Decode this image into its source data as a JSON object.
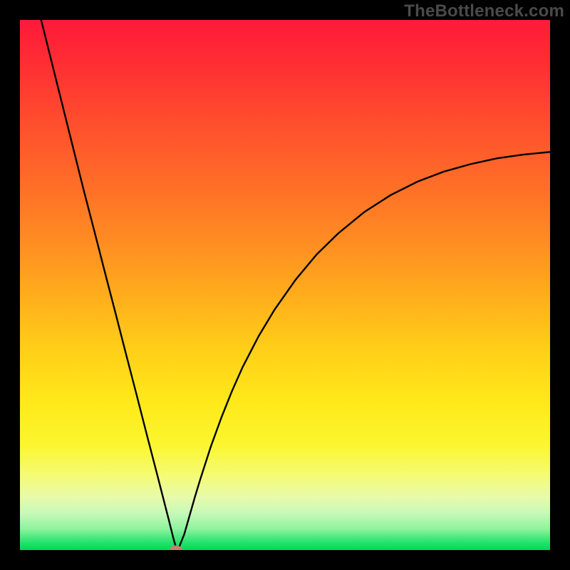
{
  "watermark": "TheBottleneck.com",
  "chart_data": {
    "type": "line",
    "title": "",
    "xlabel": "",
    "ylabel": "",
    "xlim": [
      0,
      100
    ],
    "ylim": [
      0,
      100
    ],
    "grid": false,
    "series": [
      {
        "name": "bottleneck-curve",
        "x": [
          4,
          6,
          8,
          10,
          12,
          14,
          16,
          18,
          20,
          22,
          24,
          26,
          28,
          29,
          29.5,
          30,
          31,
          32,
          33,
          34,
          36,
          38,
          40,
          42,
          45,
          48,
          52,
          56,
          60,
          65,
          70,
          75,
          80,
          85,
          90,
          95,
          100
        ],
        "y": [
          100,
          92,
          84,
          76,
          68,
          60.3,
          52.5,
          44.8,
          37,
          29.3,
          21.5,
          13.8,
          6,
          2,
          0.3,
          0.5,
          3,
          6.5,
          10,
          13.3,
          19.5,
          25,
          30,
          34.5,
          40.3,
          45.3,
          51,
          55.8,
          59.7,
          63.8,
          67,
          69.5,
          71.4,
          72.8,
          73.9,
          74.6,
          75.1
        ]
      }
    ],
    "marker": {
      "x": 29.5,
      "y": 0,
      "name": "optimal-point"
    },
    "gradient_stops": [
      {
        "pos": 0,
        "color": "#ff1a3a"
      },
      {
        "pos": 18,
        "color": "#ff4a2e"
      },
      {
        "pos": 42,
        "color": "#ff8d22"
      },
      {
        "pos": 62,
        "color": "#ffce18"
      },
      {
        "pos": 80,
        "color": "#fbf62e"
      },
      {
        "pos": 93,
        "color": "#c8f9b8"
      },
      {
        "pos": 100,
        "color": "#00d85a"
      }
    ]
  }
}
